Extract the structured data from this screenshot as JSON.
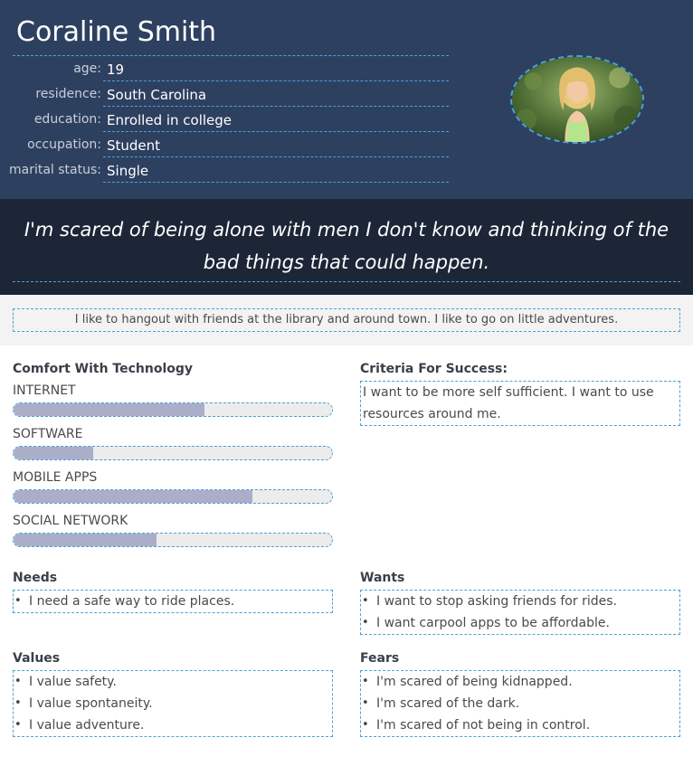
{
  "persona": {
    "name": "Coraline Smith",
    "info": [
      {
        "key": "age:",
        "value": "19"
      },
      {
        "key": "residence:",
        "value": "South Carolina"
      },
      {
        "key": "education:",
        "value": "Enrolled in college"
      },
      {
        "key": "occupation:",
        "value": "Student"
      },
      {
        "key": "marital status:",
        "value": "Single"
      }
    ],
    "quote": "I'm scared of being alone with men I don't know and thinking of the bad things that could happen.",
    "bio": "I like to hangout with friends at the library and around town. I like to go on little adventures."
  },
  "technology": {
    "title": "Comfort With Technology",
    "items": [
      {
        "label": "INTERNET",
        "level": 0.6
      },
      {
        "label": "SOFTWARE",
        "level": 0.25
      },
      {
        "label": "MOBILE APPS",
        "level": 0.75
      },
      {
        "label": "SOCIAL NETWORK",
        "level": 0.45
      }
    ]
  },
  "success": {
    "title": "Criteria For Success:",
    "text": "I want to be more self sufficient. I want to use resources around me."
  },
  "needs": {
    "title": "Needs",
    "items": [
      "I need a safe way to ride places."
    ]
  },
  "wants": {
    "title": "Wants",
    "items": [
      "I want to stop asking friends for rides.",
      "I want carpool apps to be affordable."
    ]
  },
  "values": {
    "title": "Values",
    "items": [
      "I value safety.",
      "I value spontaneity.",
      "I value adventure."
    ]
  },
  "fears": {
    "title": "Fears",
    "items": [
      "I'm scared of being kidnapped.",
      "I'm scared of the dark.",
      "I'm scared of not being in control."
    ]
  },
  "colors": {
    "header": "#2e4060",
    "quote_band": "#1c2637",
    "bar_fill": "#abaec9",
    "dashed_outline": "#4aa3d6"
  }
}
